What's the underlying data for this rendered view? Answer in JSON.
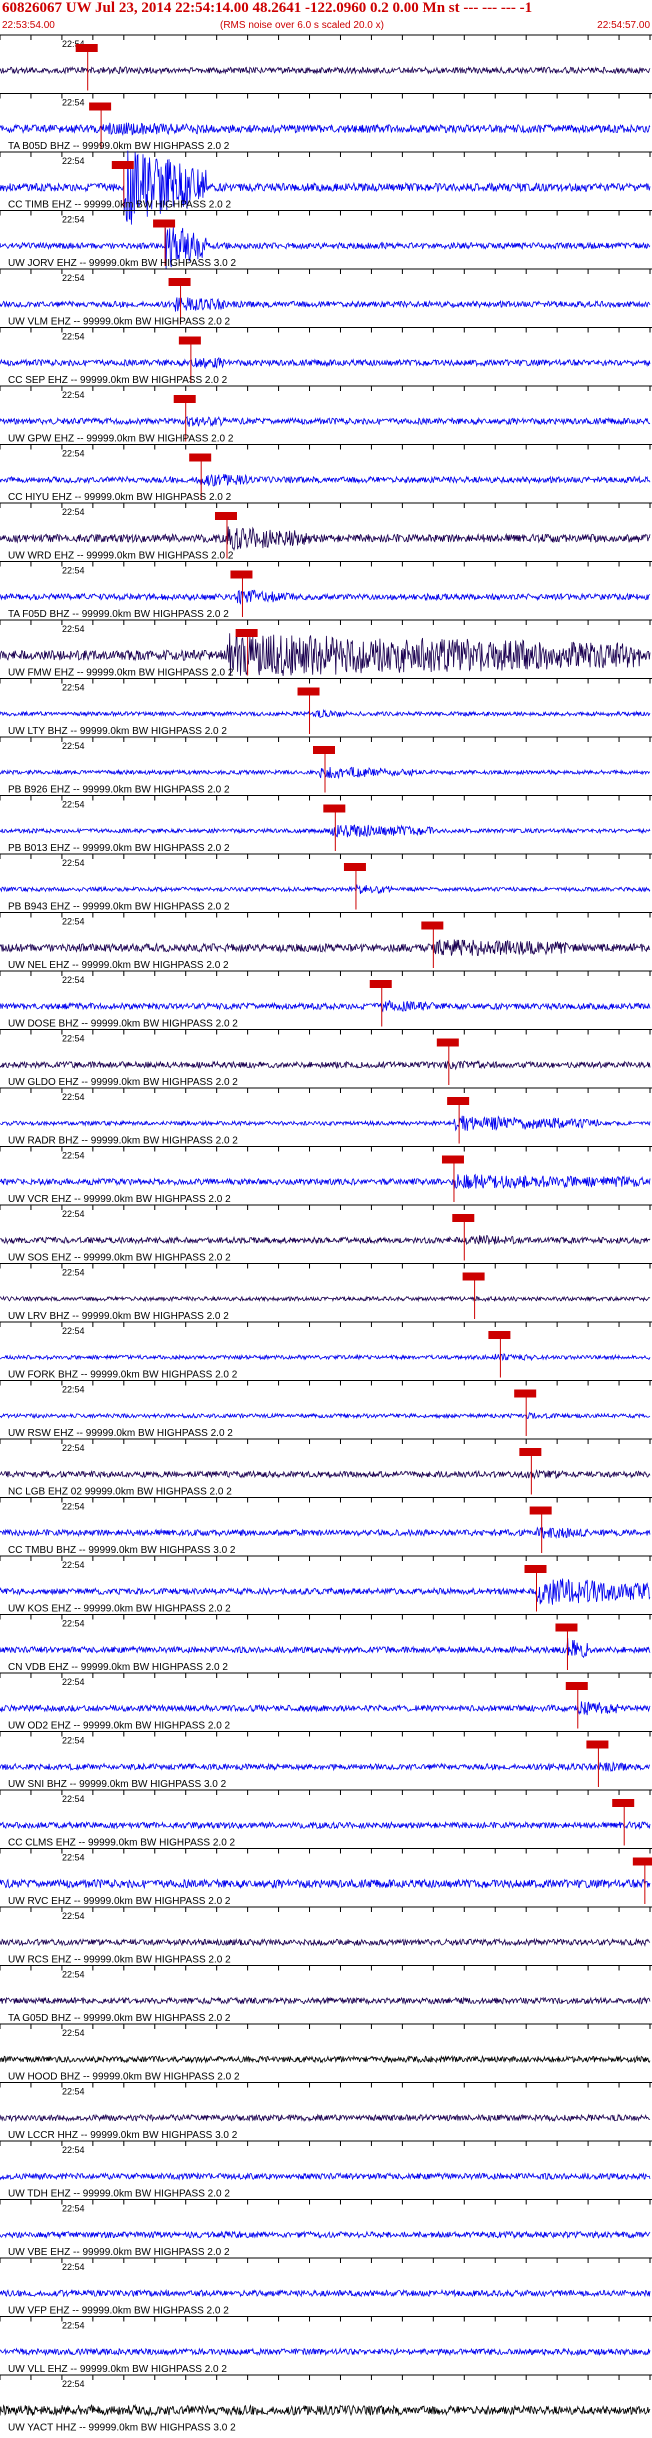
{
  "header": {
    "title": "60826067 UW Jul 23, 2014 22:54:14.00   48.2641 -122.0960  0.2 0.00 Mn st --- --- --- -1",
    "start_time": "22:53:54.00",
    "end_time": "22:54:57.00",
    "rms_note": "(RMS noise over 6.0 s scaled 20.0 x)"
  },
  "chart_data": {
    "type": "line",
    "time_label": "22:54",
    "tick_seconds": [
      0,
      3,
      6,
      9,
      12,
      15,
      18,
      21,
      24,
      27,
      30,
      33,
      36,
      39,
      42,
      45,
      48,
      51,
      54,
      57,
      60,
      63
    ],
    "time_range_s": [
      0,
      63
    ],
    "pick_color": "#cc0000",
    "traces": [
      {
        "label": "",
        "color": "#1a0050",
        "amp": 3,
        "pick_s": 8.5,
        "burst": [
          9,
          15,
          1.2
        ],
        "seed": 1
      },
      {
        "label": "TA B05D BHZ -- 99999.0km BW  HIGHPASS  2.0  2",
        "color": "#0000ee",
        "amp": 4,
        "pick_s": 9.8,
        "burst": [
          10,
          20,
          1.6
        ],
        "seed": 2
      },
      {
        "label": "CC TIMB EHZ -- 99999.0km BW  HIGHPASS  2.0  2",
        "color": "#0000ee",
        "amp": 4,
        "pick_s": 12.0,
        "burst": [
          12,
          20,
          10
        ],
        "seed": 3
      },
      {
        "label": "UW JORV EHZ -- 99999.0km BW  HIGHPASS  3.0  2",
        "color": "#0000ee",
        "amp": 3,
        "pick_s": 16.0,
        "burst": [
          16,
          20,
          8
        ],
        "seed": 4
      },
      {
        "label": "UW VLM EHZ -- 99999.0km BW  HIGHPASS  2.0  2",
        "color": "#0000ee",
        "amp": 3,
        "pick_s": 17.5,
        "burst": [
          17,
          22,
          2.5
        ],
        "seed": 5
      },
      {
        "label": "CC SEP EHZ -- 99999.0km BW  HIGHPASS  2.0  2",
        "color": "#0000ee",
        "amp": 3,
        "pick_s": 18.5,
        "burst": [
          18.5,
          22,
          2.2
        ],
        "seed": 6
      },
      {
        "label": "UW GPW EHZ -- 99999.0km BW  HIGHPASS  2.0  2",
        "color": "#0000ee",
        "amp": 3,
        "pick_s": 18.0,
        "burst": [
          18,
          22,
          2
        ],
        "seed": 7
      },
      {
        "label": "CC HIYU EHZ -- 99999.0km BW  HIGHPASS  2.0  2",
        "color": "#0000ee",
        "amp": 3,
        "pick_s": 19.5,
        "burst": [
          19,
          24,
          2.4
        ],
        "seed": 8
      },
      {
        "label": "UW WRD EHZ -- 99999.0km BW  HIGHPASS  2.0  2",
        "color": "#1a0050",
        "amp": 4,
        "pick_s": 22.0,
        "burst": [
          22,
          30,
          3
        ],
        "seed": 9
      },
      {
        "label": "TA F05D BHZ -- 99999.0km BW  HIGHPASS  2.0  2",
        "color": "#0000ee",
        "amp": 3,
        "pick_s": 23.5,
        "burst": [
          23,
          28,
          2.5
        ],
        "seed": 10
      },
      {
        "label": "UW FMW EHZ -- 99999.0km BW  HIGHPASS  2.0  2",
        "color": "#1a0050",
        "amp": 5,
        "pick_s": 24.0,
        "burst": [
          22,
          62,
          4.5
        ],
        "seed": 11
      },
      {
        "label": "UW LTY BHZ -- 99999.0km BW  HIGHPASS  2.0  2",
        "color": "#0000ee",
        "amp": 2,
        "pick_s": 30.0,
        "burst": [
          30,
          34,
          2
        ],
        "seed": 12
      },
      {
        "label": "PB B926 EHZ -- 99999.0km BW  HIGHPASS  2.0  2",
        "color": "#0000ee",
        "amp": 2,
        "pick_s": 31.5,
        "burst": [
          31,
          40,
          3
        ],
        "seed": 13
      },
      {
        "label": "PB B013 EHZ -- 99999.0km BW  HIGHPASS  2.0  2",
        "color": "#0000ee",
        "amp": 2,
        "pick_s": 32.5,
        "burst": [
          32,
          42,
          3.5
        ],
        "seed": 14
      },
      {
        "label": "PB B943 EHZ -- 99999.0km BW  HIGHPASS  2.0  2",
        "color": "#0000ee",
        "amp": 2,
        "pick_s": 34.5,
        "burst": [
          34.5,
          38,
          2.5
        ],
        "seed": 15
      },
      {
        "label": "UW NEL EHZ -- 99999.0km BW  HIGHPASS  2.0  2",
        "color": "#1a0050",
        "amp": 4,
        "pick_s": 42.0,
        "burst": [
          42,
          55,
          2.2
        ],
        "seed": 16
      },
      {
        "label": "UW DOSE BHZ -- 99999.0km BW  HIGHPASS  2.0  2",
        "color": "#0000ee",
        "amp": 3,
        "pick_s": 37.0,
        "burst": [
          37,
          42,
          2
        ],
        "seed": 17
      },
      {
        "label": "UW GLDO EHZ -- 99999.0km BW  HIGHPASS  2.0  2",
        "color": "#1a0050",
        "amp": 3,
        "pick_s": 43.5,
        "burst": [
          43,
          47,
          1.5
        ],
        "seed": 18
      },
      {
        "label": "UW RADR BHZ -- 99999.0km BW  HIGHPASS  2.0  2",
        "color": "#0000ee",
        "amp": 2,
        "pick_s": 44.5,
        "burst": [
          44,
          58,
          4
        ],
        "seed": 19
      },
      {
        "label": "UW VCR EHZ -- 99999.0km BW  HIGHPASS  2.0  2",
        "color": "#0000ee",
        "amp": 3,
        "pick_s": 44.0,
        "burst": [
          44,
          63,
          2.5
        ],
        "seed": 20
      },
      {
        "label": "UW SOS EHZ -- 99999.0km BW  HIGHPASS  2.0  2",
        "color": "#1a0050",
        "amp": 3,
        "pick_s": 45.0,
        "burst": [
          45,
          50,
          1.8
        ],
        "seed": 21
      },
      {
        "label": "UW LRV BHZ -- 99999.0km BW  HIGHPASS  2.0  2",
        "color": "#1a0050",
        "amp": 2,
        "pick_s": 46.0,
        "burst": [
          46,
          50,
          1.4
        ],
        "seed": 22
      },
      {
        "label": "UW FORK BHZ -- 99999.0km BW  HIGHPASS  2.0  2",
        "color": "#0000ee",
        "amp": 2,
        "pick_s": 48.5,
        "burst": [
          48,
          52,
          1.8
        ],
        "seed": 23
      },
      {
        "label": "UW RSW EHZ -- 99999.0km BW  HIGHPASS  2.0  2",
        "color": "#0000ee",
        "amp": 2,
        "pick_s": 51.0,
        "burst": [
          51,
          54,
          1.6
        ],
        "seed": 24
      },
      {
        "label": "NC LGB EHZ 02 99999.0km BW  HIGHPASS  2.0  2",
        "color": "#1a0050",
        "amp": 3,
        "pick_s": 51.5,
        "burst": [
          51,
          55,
          1.6
        ],
        "seed": 25
      },
      {
        "label": "CC TMBU BHZ -- 99999.0km BW  HIGHPASS  3.0  2",
        "color": "#0000ee",
        "amp": 3,
        "pick_s": 52.5,
        "burst": [
          52,
          57,
          2
        ],
        "seed": 26
      },
      {
        "label": "UW KOS EHZ -- 99999.0km BW  HIGHPASS  2.0  2",
        "color": "#0000ee",
        "amp": 3,
        "pick_s": 52.0,
        "burst": [
          52,
          63,
          5
        ],
        "seed": 27
      },
      {
        "label": "CN VDB EHZ -- 99999.0km BW  HIGHPASS  2.0  2",
        "color": "#0000ee",
        "amp": 3,
        "pick_s": 55.0,
        "burst": [
          55,
          57,
          4
        ],
        "seed": 28
      },
      {
        "label": "UW OD2 EHZ -- 99999.0km BW  HIGHPASS  2.0  2",
        "color": "#0000ee",
        "amp": 3,
        "pick_s": 56.0,
        "burst": [
          56,
          60,
          2.5
        ],
        "seed": 29
      },
      {
        "label": "UW SNI BHZ -- 99999.0km BW  HIGHPASS  3.0  2",
        "color": "#0000ee",
        "amp": 3,
        "pick_s": 58.0,
        "burst": [
          58,
          61,
          1.6
        ],
        "seed": 30
      },
      {
        "label": "CC CLMS EHZ -- 99999.0km BW  HIGHPASS  2.0  2",
        "color": "#0000ee",
        "amp": 3,
        "pick_s": 60.5,
        "burst": [
          60,
          63,
          1.2
        ],
        "seed": 31
      },
      {
        "label": "UW RVC EHZ -- 99999.0km BW  HIGHPASS  2.0  2",
        "color": "#0000ee",
        "amp": 4,
        "pick_s": 62.5,
        "burst": [
          62,
          63,
          1.2
        ],
        "seed": 32
      },
      {
        "label": "UW RCS EHZ -- 99999.0km BW  HIGHPASS  2.0  2",
        "color": "#1a0050",
        "amp": 3,
        "pick_s": null,
        "burst": null,
        "seed": 33
      },
      {
        "label": "TA G05D BHZ -- 99999.0km BW  HIGHPASS  2.0  2",
        "color": "#1a0050",
        "amp": 3,
        "pick_s": null,
        "burst": null,
        "seed": 34
      },
      {
        "label": "UW HOOD BHZ -- 99999.0km BW  HIGHPASS  2.0  2",
        "color": "#000000",
        "amp": 3,
        "pick_s": null,
        "burst": null,
        "seed": 35
      },
      {
        "label": "UW LCCR HHZ -- 99999.0km BW  HIGHPASS  3.0  2",
        "color": "#1a0050",
        "amp": 3,
        "pick_s": null,
        "burst": null,
        "seed": 36
      },
      {
        "label": "UW TDH EHZ -- 99999.0km BW  HIGHPASS  2.0  2",
        "color": "#0000ee",
        "amp": 3,
        "pick_s": null,
        "burst": null,
        "seed": 37
      },
      {
        "label": "UW VBE EHZ -- 99999.0km BW  HIGHPASS  2.0  2",
        "color": "#0000ee",
        "amp": 3,
        "pick_s": null,
        "burst": null,
        "seed": 38
      },
      {
        "label": "UW VFP EHZ -- 99999.0km BW  HIGHPASS  2.0  2",
        "color": "#0000ee",
        "amp": 3,
        "pick_s": null,
        "burst": null,
        "seed": 39
      },
      {
        "label": "UW VLL EHZ -- 99999.0km BW  HIGHPASS  2.0  2",
        "color": "#0000ee",
        "amp": 3,
        "pick_s": null,
        "burst": null,
        "seed": 40
      },
      {
        "label": "UW YACT HHZ -- 99999.0km BW  HIGHPASS  3.0  2",
        "color": "#000000",
        "amp": 3,
        "pick_s": null,
        "burst": [
          0,
          63,
          1.8
        ],
        "seed": 41
      }
    ]
  }
}
